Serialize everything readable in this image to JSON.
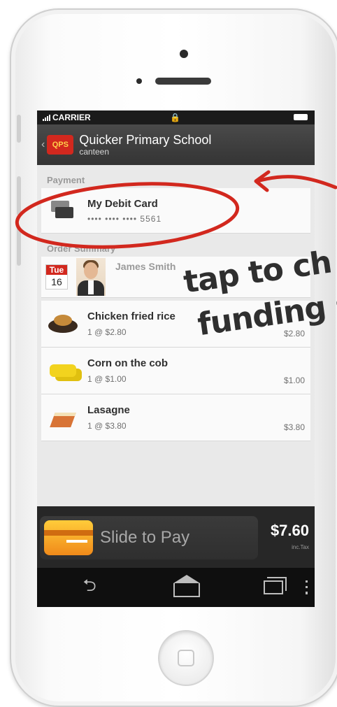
{
  "status_bar": {
    "carrier": "CARRIER"
  },
  "app_bar": {
    "logo_text": "QPS",
    "title": "Quicker Primary School",
    "subtitle": "canteen"
  },
  "payment": {
    "section_label": "Payment",
    "card_name": "My Debit Card",
    "card_number": "•••• •••• •••• 5561"
  },
  "order": {
    "section_label": "Order Summary",
    "day_of_week": "Tue",
    "day_number": "16",
    "person_name": "James Smith",
    "items": [
      {
        "name": "Chicken fried rice",
        "qty": "1 @ $2.80",
        "price": "$2.80",
        "icon": "rice-icon"
      },
      {
        "name": "Corn on the cob",
        "qty": "1 @ $1.00",
        "price": "$1.00",
        "icon": "corn-icon"
      },
      {
        "name": "Lasagne",
        "qty": "1 @ $3.80",
        "price": "$3.80",
        "icon": "lasagne-icon"
      }
    ]
  },
  "pay_bar": {
    "slide_label": "Slide to Pay",
    "total": "$7.60",
    "tax_note": "inc.Tax"
  },
  "annotation": {
    "line1": "tap to ch",
    "line2": "funding s"
  },
  "colors": {
    "accent_red": "#d2281e",
    "slider_orange": "#f08a1a"
  }
}
